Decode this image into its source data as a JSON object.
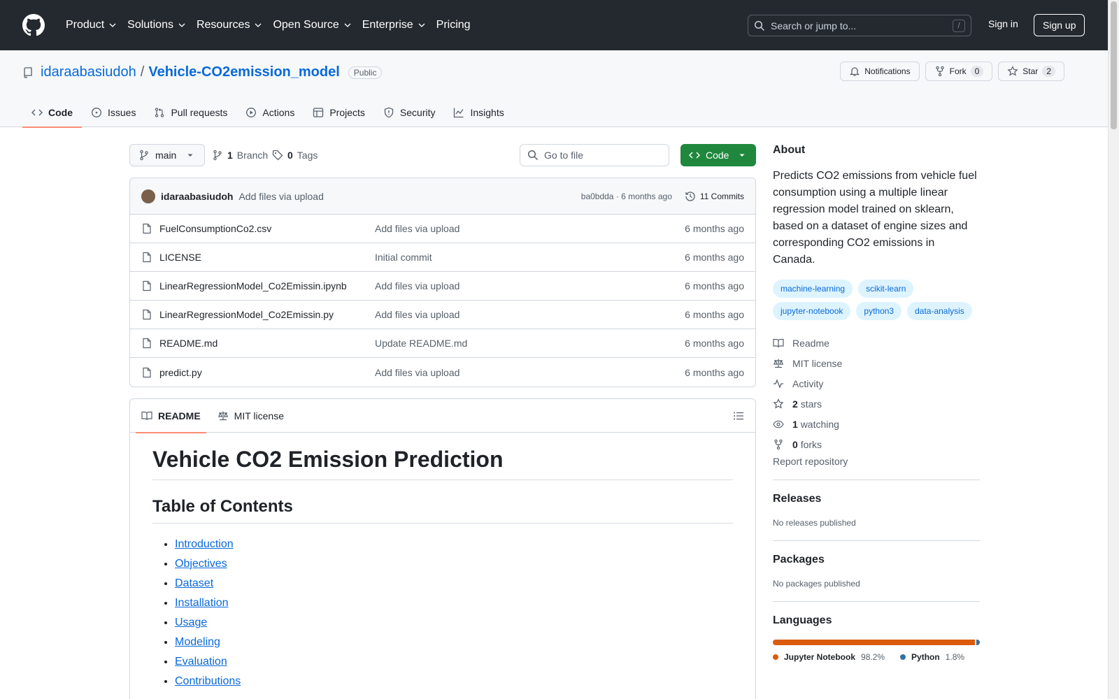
{
  "header": {
    "nav": [
      "Product",
      "Solutions",
      "Resources",
      "Open Source",
      "Enterprise",
      "Pricing"
    ],
    "search_placeholder": "Search or jump to...",
    "search_shortcut": "/",
    "sign_in": "Sign in",
    "sign_up": "Sign up"
  },
  "repo": {
    "owner": "idaraabasiudoh",
    "separator": "/",
    "name": "Vehicle-CO2emission_model",
    "visibility": "Public",
    "notifications": "Notifications",
    "fork_label": "Fork",
    "fork_count": "0",
    "star_label": "Star",
    "star_count": "2",
    "tabs": [
      "Code",
      "Issues",
      "Pull requests",
      "Actions",
      "Projects",
      "Security",
      "Insights"
    ]
  },
  "toolbar": {
    "branch": "main",
    "branch_count": "1",
    "branch_label": "Branch",
    "tag_count": "0",
    "tag_label": "Tags",
    "goto_placeholder": "Go to file",
    "code_button": "Code"
  },
  "latest_commit": {
    "author": "idaraabasiudoh",
    "message": "Add files via upload",
    "meta": "ba0bdda · 6 months ago",
    "commits_label": "11 Commits"
  },
  "files": [
    {
      "name": "FuelConsumptionCo2.csv",
      "message": "Add files via upload",
      "age": "6 months ago"
    },
    {
      "name": "LICENSE",
      "message": "Initial commit",
      "age": "6 months ago"
    },
    {
      "name": "LinearRegressionModel_Co2Emissin.ipynb",
      "message": "Add files via upload",
      "age": "6 months ago"
    },
    {
      "name": "LinearRegressionModel_Co2Emissin.py",
      "message": "Add files via upload",
      "age": "6 months ago"
    },
    {
      "name": "README.md",
      "message": "Update README.md",
      "age": "6 months ago"
    },
    {
      "name": "predict.py",
      "message": "Add files via upload",
      "age": "6 months ago"
    }
  ],
  "readme": {
    "tab_readme": "README",
    "tab_license": "MIT license",
    "title": "Vehicle CO2 Emission Prediction",
    "toc_heading": "Table of Contents",
    "toc": [
      "Introduction",
      "Objectives",
      "Dataset",
      "Installation",
      "Usage",
      "Modeling",
      "Evaluation",
      "Contributions"
    ]
  },
  "about": {
    "heading": "About",
    "description": "Predicts CO2 emissions from vehicle fuel consumption using a multiple linear regression model trained on sklearn, based on a dataset of engine sizes and corresponding CO2 emissions in Canada.",
    "topics": [
      "machine-learning",
      "scikit-learn",
      "jupyter-notebook",
      "python3",
      "data-analysis"
    ],
    "readme": "Readme",
    "license": "MIT license",
    "activity": "Activity",
    "stars_num": "2",
    "stars_label": "stars",
    "watching_num": "1",
    "watching_label": "watching",
    "forks_num": "0",
    "forks_label": "forks",
    "report": "Report repository"
  },
  "releases": {
    "heading": "Releases",
    "text": "No releases published"
  },
  "packages": {
    "heading": "Packages",
    "text": "No packages published"
  },
  "languages": {
    "heading": "Languages",
    "items": [
      {
        "name": "Jupyter Notebook",
        "percent": "98.2%",
        "value": 98.2,
        "color": "#DA5B0B"
      },
      {
        "name": "Python",
        "percent": "1.8%",
        "value": 1.8,
        "color": "#3572A5"
      }
    ]
  }
}
